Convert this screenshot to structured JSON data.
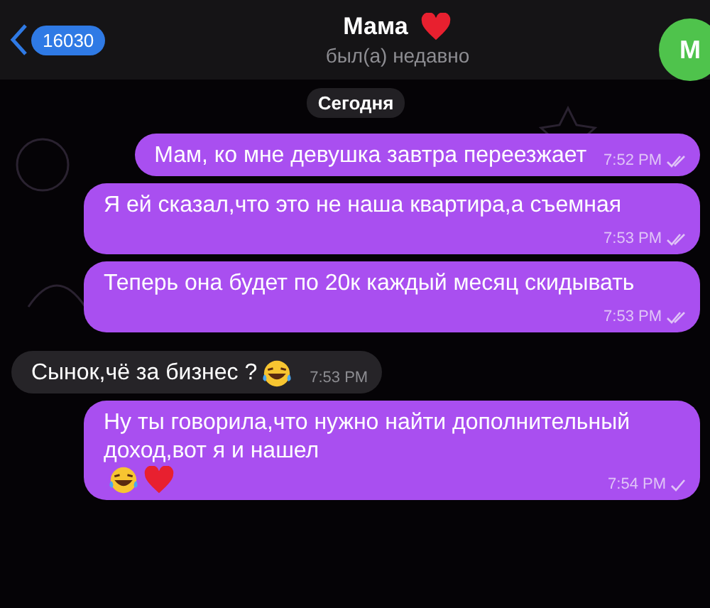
{
  "header": {
    "back_count": "16030",
    "title": "Мама",
    "title_heart": true,
    "status": "был(а) недавно",
    "avatar_letter": "М"
  },
  "date_label": "Сегодня",
  "messages": [
    {
      "outgoing": true,
      "text": "Мам, ко мне девушка завтра переезжает",
      "time": "7:52 PM",
      "read": true
    },
    {
      "outgoing": true,
      "text": "Я ей сказал,что это не наша квартира,а съемная",
      "time": "7:53 PM",
      "read": true
    },
    {
      "outgoing": true,
      "text": "Теперь она будет по 20к каждый месяц скидывать",
      "time": "7:53 PM",
      "read": true
    },
    {
      "outgoing": false,
      "text": "Сынок,чё за бизнес ?",
      "time": "7:53 PM",
      "emojis": [
        {
          "kind": "laugh"
        }
      ]
    },
    {
      "outgoing": true,
      "text": "Ну ты говорила,что нужно найти дополнительный доход,вот я и нашел",
      "time": "7:54 PM",
      "read": false,
      "emojis": [
        {
          "kind": "laugh"
        },
        {
          "kind": "heart"
        }
      ]
    }
  ]
}
